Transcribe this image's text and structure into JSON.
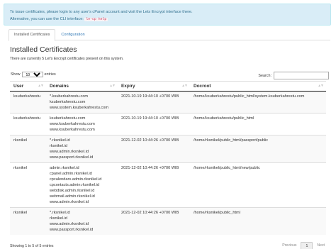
{
  "alert": {
    "line1": "To issue certificates, please login to any user's cPanel account and visit the Lets Encrypt interface there.",
    "line2_prefix": "Alternative, you can use the CLI interface:",
    "code": "le-cp help"
  },
  "tabs": [
    {
      "label": "Installed Certificates",
      "active": true
    },
    {
      "label": "Configuration",
      "active": false
    }
  ],
  "heading": "Installed Certificates",
  "subtext": "There are currently 5 Let's Encrypt certificates present on this system.",
  "length": {
    "show": "Show",
    "value": "10",
    "entries": "entries"
  },
  "search": {
    "label": "Search:",
    "value": ""
  },
  "table": {
    "columns": [
      "User",
      "Domains",
      "Expiry",
      "Docroot"
    ],
    "rows": [
      {
        "user": "ksuberkahrestu",
        "domains": [
          "*.ksuberkahrestu.com",
          "ksuberkahrestu.com",
          "www.system.ksuberkahrestu.com"
        ],
        "expiry": "2021-10-19 19:44:10 +0700 WIB",
        "docroot": "/home/ksuberkahrestu/public_html/system.ksuberkahrestu.com"
      },
      {
        "user": "ksuberkahrestu",
        "domains": [
          "ksuberkahrestu.com",
          "www.ksuberkahrestu.com",
          "www.ksuberkahrestu.com"
        ],
        "expiry": "2021-10-19 19:44:10 +0700 WIB",
        "docroot": "/home/ksuberkahrestu/public_html"
      },
      {
        "user": "rksnikel",
        "domains": [
          "*.rksnikel.id",
          "rksnikel.id",
          "www.admin.rksnikel.id",
          "www.passport.rksnikel.id"
        ],
        "expiry": "2021-12-02 10:44:26 +0700 WIB",
        "docroot": "/home/rksnikel/public_html/passport/public"
      },
      {
        "user": "rksnikel",
        "domains": [
          "admin.rksnikel.id",
          "cpanel.admin.rksnikel.id",
          "cpcalendars.admin.rksnikel.id",
          "cpcontacts.admin.rksnikel.id",
          "webdisk.admin.rksnikel.id",
          "webmail.admin.rksnikel.id",
          "www.admin.rksnikel.id"
        ],
        "expiry": "2021-12-02 10:44:26 +0700 WIB",
        "docroot": "/home/rksnikel/public_html/new/public"
      },
      {
        "user": "rksnikel",
        "domains": [
          "*.rksnikel.id",
          "rksnikel.id",
          "www.admin.rksnikel.id",
          "www.passport.rksnikel.id"
        ],
        "expiry": "2021-12-02 10:44:26 +0700 WIB",
        "docroot": "/home/rksnikel/public_html"
      }
    ]
  },
  "footer": {
    "info": "Showing 1 to 5 of 5 entries",
    "previous": "Previous",
    "page": "1",
    "next": "Next"
  }
}
